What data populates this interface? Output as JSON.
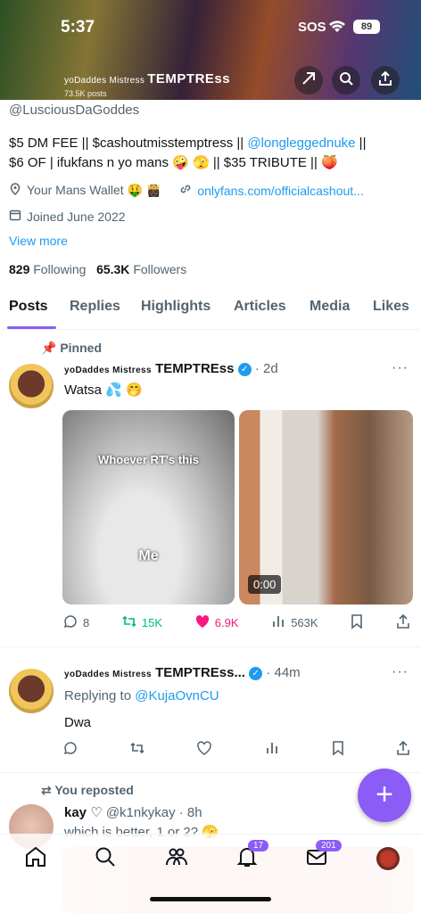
{
  "status": {
    "time": "5:37",
    "carrier": "SOS",
    "battery": "89"
  },
  "header": {
    "display_name_prefix": "yoDaddes Mistress",
    "display_name_main": "TEMPTREss",
    "posts_count": "73.5K posts"
  },
  "profile": {
    "handle": "@LusciousDaGoddes",
    "bio_line1_prefix": "$5 DM FEE || $cashoutmisstemptress || ",
    "bio_line1_link": "@longleggednuke",
    "bio_line1_suffix": " ||",
    "bio_line2": "$6 OF | ifukfans n yo mans 🤪 🫣 || $35 TRIBUTE || 🍑",
    "location": "Your Mans Wallet 🤑 👸🏿",
    "website": "onlyfans.com/officialcashout...",
    "joined": "Joined June 2022",
    "view_more": "View more",
    "following_count": "829",
    "following_label": "Following",
    "followers_count": "65.3K",
    "followers_label": "Followers"
  },
  "tabs": [
    "Posts",
    "Replies",
    "Highlights",
    "Articles",
    "Media",
    "Likes"
  ],
  "posts": [
    {
      "pinned_label": "Pinned",
      "name_prefix": "yoDaddes Mistress",
      "name_main": "TEMPTREss",
      "time": "· 2d",
      "text": "Watsa 💦 🤭",
      "image1_caption_top": "Whoever RT's this",
      "image1_caption_bottom": "Me",
      "video_time": "0:00",
      "replies": "8",
      "reposts": "15K",
      "likes": "6.9K",
      "views": "563K"
    },
    {
      "name_prefix": "yoDaddes Mistress",
      "name_main": "TEMPTREss...",
      "time": "· 44m",
      "replying_label": "Replying to",
      "replying_to": "@KujaOvnCU",
      "text": "Dwa"
    },
    {
      "repost_label": "You reposted",
      "name": "kay ♡",
      "handle_time": "@k1nkykay · 8h",
      "text": "which is better, 1 or 2? 🫣"
    }
  ],
  "nav": {
    "notifications_badge": "17",
    "messages_badge": "201"
  },
  "colors": {
    "accent": "#8b5cf6",
    "link": "#1d9bf0",
    "like": "#f91880",
    "repost": "#00ba7c"
  }
}
